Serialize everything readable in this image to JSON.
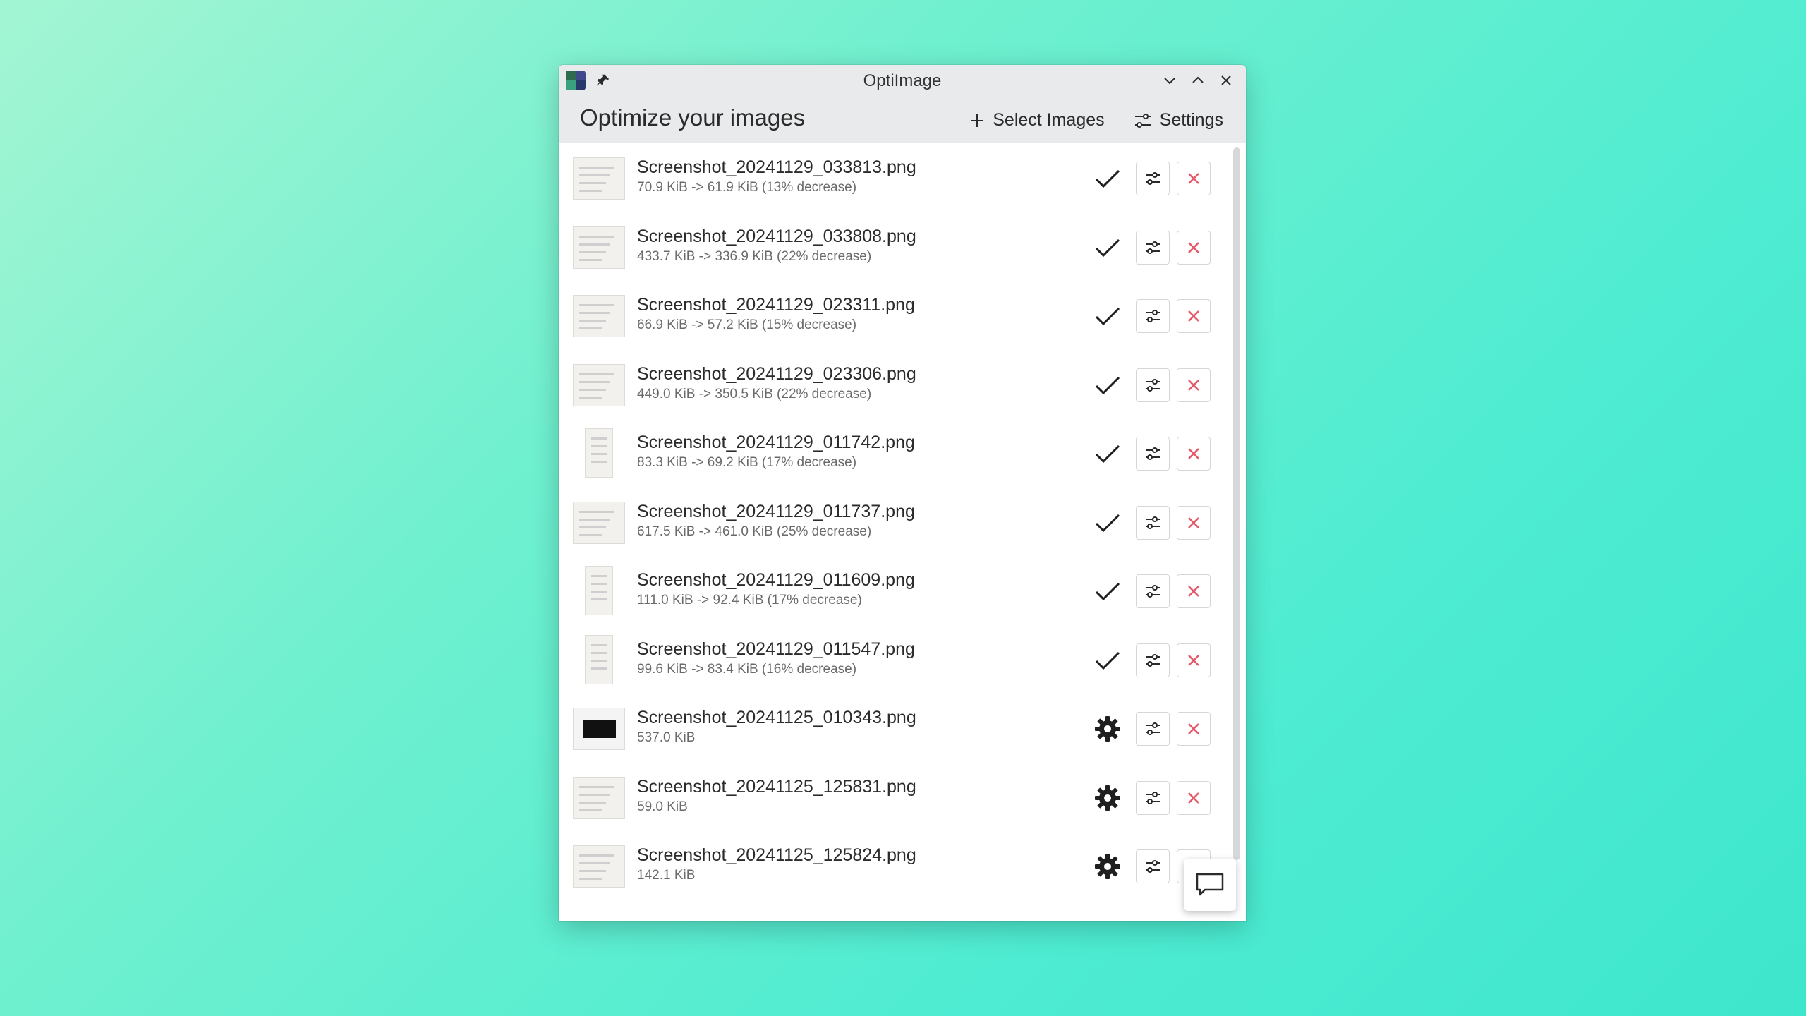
{
  "window": {
    "title": "OptiImage"
  },
  "header": {
    "page_title": "Optimize your images",
    "select_images_label": "Select Images",
    "settings_label": "Settings"
  },
  "colors": {
    "remove_icon": "#e35a6a",
    "status_icon": "#1f1f1f"
  },
  "images": [
    {
      "name": "Screenshot_20241129_033813.png",
      "size": "70.9 KiB -> 61.9 KiB (13% decrease)",
      "status": "done",
      "status_icon": "checkmark-icon"
    },
    {
      "name": "Screenshot_20241129_033808.png",
      "size": "433.7 KiB -> 336.9 KiB (22% decrease)",
      "status": "done",
      "status_icon": "checkmark-icon"
    },
    {
      "name": "Screenshot_20241129_023311.png",
      "size": "66.9 KiB -> 57.2 KiB (15% decrease)",
      "status": "done",
      "status_icon": "checkmark-icon"
    },
    {
      "name": "Screenshot_20241129_023306.png",
      "size": "449.0 KiB -> 350.5 KiB (22% decrease)",
      "status": "done",
      "status_icon": "checkmark-icon"
    },
    {
      "name": "Screenshot_20241129_011742.png",
      "size": "83.3 KiB -> 69.2 KiB (17% decrease)",
      "status": "done",
      "status_icon": "checkmark-icon"
    },
    {
      "name": "Screenshot_20241129_011737.png",
      "size": "617.5 KiB -> 461.0 KiB (25% decrease)",
      "status": "done",
      "status_icon": "checkmark-icon"
    },
    {
      "name": "Screenshot_20241129_011609.png",
      "size": "111.0 KiB -> 92.4 KiB (17% decrease)",
      "status": "done",
      "status_icon": "checkmark-icon"
    },
    {
      "name": "Screenshot_20241129_011547.png",
      "size": "99.6 KiB -> 83.4 KiB (16% decrease)",
      "status": "done",
      "status_icon": "checkmark-icon"
    },
    {
      "name": "Screenshot_20241125_010343.png",
      "size": "537.0 KiB",
      "status": "processing",
      "status_icon": "gear-icon"
    },
    {
      "name": "Screenshot_20241125_125831.png",
      "size": "59.0 KiB",
      "status": "processing",
      "status_icon": "gear-icon"
    },
    {
      "name": "Screenshot_20241125_125824.png",
      "size": "142.1 KiB",
      "status": "processing",
      "status_icon": "gear-icon"
    }
  ]
}
